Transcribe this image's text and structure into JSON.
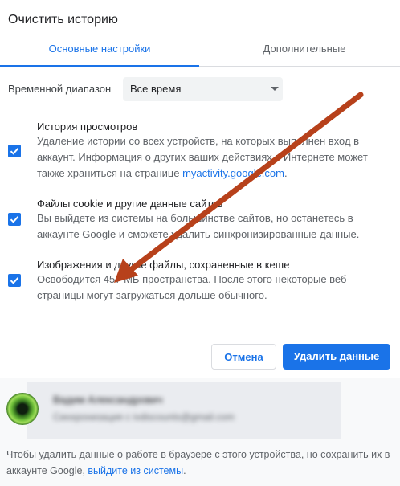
{
  "dialog": {
    "title": "Очистить историю",
    "tabs": [
      {
        "label": "Основные настройки",
        "active": true
      },
      {
        "label": "Дополнительные",
        "active": false
      }
    ],
    "time_range": {
      "label": "Временной диапазон",
      "value": "Все время"
    },
    "options": [
      {
        "title": "История просмотров",
        "description": "Удаление истории со всех устройств, на которых выполнен вход в аккаунт. Информация о других ваших действиях в Интернете может также храниться на странице ",
        "link": "myactivity.google.com",
        "description_end": ".",
        "checked": true
      },
      {
        "title": "Файлы cookie и другие данные сайтов",
        "description": "Вы выйдете из системы на большинстве сайтов, но останетесь в аккаунте Google и сможете удалить синхронизированные данные.",
        "checked": true
      },
      {
        "title": "Изображения и другие файлы, сохраненные в кеше",
        "description": "Освободится 457 МБ пространства. После этого некоторые веб-страницы могут загружаться дольше обычного.",
        "checked": true
      }
    ],
    "buttons": {
      "cancel": "Отмена",
      "delete": "Удалить данные"
    }
  },
  "account": {
    "name": "Вадим Александрович",
    "sync_status": "Синхронизация с ivdiscounts@gmail.com"
  },
  "footer": {
    "text": "Чтобы удалить данные о работе в браузере с этого устройства, но сохранить их в аккаунте Google, ",
    "link": "выйдите из системы",
    "text_end": "."
  },
  "colors": {
    "accent": "#1a73e8",
    "annotation_arrow": "#b7411b"
  }
}
